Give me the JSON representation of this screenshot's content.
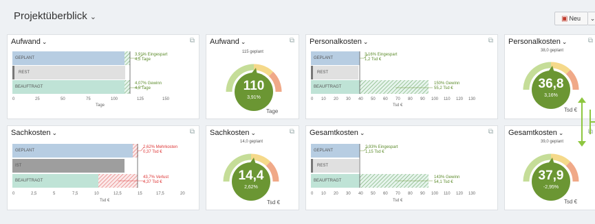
{
  "header": {
    "title": "Projektüberblick",
    "new_button_label": "Neu"
  },
  "colors": {
    "planned": "#b7cde2",
    "rest": "#e0e0e0",
    "ist": "#9e9e9e",
    "assigned": "#bfe3d6",
    "gauge_dark": "#6b9633",
    "gauge_light": "#c5dd98",
    "gauge_yellow": "#f5d98a",
    "gauge_orange": "#f0a988",
    "annotation_green": "#5b8a2a",
    "annotation_red": "#d33333",
    "resize_arrow": "#8dc63f"
  },
  "cards": {
    "aufwand_bar": {
      "title": "Aufwand",
      "bars": [
        "GEPLANT",
        "REST",
        "BEAUFTRAGT"
      ],
      "ann1": [
        "3,91% Eingespart",
        "4,5 Tage"
      ],
      "ann2": [
        "4,07% Gewinn",
        "4,5 Tage"
      ],
      "ticks": [
        "0",
        "25",
        "50",
        "75",
        "100",
        "125",
        "150"
      ],
      "unit": "Tage",
      "values": {
        "planned": 115,
        "rest": 110,
        "assigned": 115
      }
    },
    "aufwand_gauge": {
      "title": "Aufwand",
      "planned_label": "115 geplant",
      "value": "110",
      "percent": "3,91%",
      "unit": "Tage"
    },
    "personal_bar": {
      "title": "Personalkosten",
      "bars": [
        "GEPLANT",
        "REST",
        "BEAUFTRAGT"
      ],
      "ann1": [
        "3,16% Eingespart",
        "1,2 Tsd €"
      ],
      "ann2": [
        "150% Gewinn",
        "55,2 Tsd €"
      ],
      "ticks": [
        "0",
        "10",
        "20",
        "30",
        "40",
        "50",
        "60",
        "70",
        "80",
        "90",
        "100",
        "110",
        "120",
        "130"
      ],
      "unit": "Tsd €",
      "values": {
        "planned": 38,
        "rest": 36.8,
        "assigned": 93
      }
    },
    "personal_gauge": {
      "title": "Personalkosten",
      "planned_label": "38,0 geplant",
      "value": "36,8",
      "percent": "3,16%",
      "unit": "Tsd €"
    },
    "sach_bar": {
      "title": "Sachkosten",
      "bars": [
        "GEPLANT",
        "IST",
        "BEAUFTRAGT"
      ],
      "ann1": [
        "2,62% Mehrkosten",
        "0,37 Tsd €"
      ],
      "ann2": [
        "43,7% Verlust",
        "4,37 Tsd €"
      ],
      "ticks": [
        "0",
        "2,5",
        "5",
        "7,5",
        "10",
        "12,5",
        "15",
        "17,5",
        "20"
      ],
      "unit": "Tsd €",
      "values": {
        "planned": 14,
        "ist": 14.4,
        "assigned": 10
      }
    },
    "sach_gauge": {
      "title": "Sachkosten",
      "planned_label": "14,0 geplant",
      "value": "14,4",
      "percent": "2,62%",
      "unit": "Tsd €"
    },
    "gesamt_bar": {
      "title": "Gesamtkosten",
      "bars": [
        "GEPLANT",
        "REST",
        "BEAUFTRAGT"
      ],
      "ann1": [
        "2,93% Eingespart",
        "1,15 Tsd €"
      ],
      "ann2": [
        "143% Gewinn",
        "54,1 Tsd €"
      ],
      "ticks": [
        "0",
        "10",
        "20",
        "30",
        "40",
        "50",
        "60",
        "70",
        "80",
        "90",
        "100",
        "110",
        "120",
        "130"
      ],
      "unit": "Tsd €",
      "values": {
        "planned": 39,
        "rest": 37.9,
        "assigned": 93
      }
    },
    "gesamt_gauge": {
      "title": "Gesamtkosten",
      "planned_label": "39,0 geplant",
      "value": "37,9",
      "percent": "-2,95%",
      "unit": "Tsd €"
    }
  }
}
